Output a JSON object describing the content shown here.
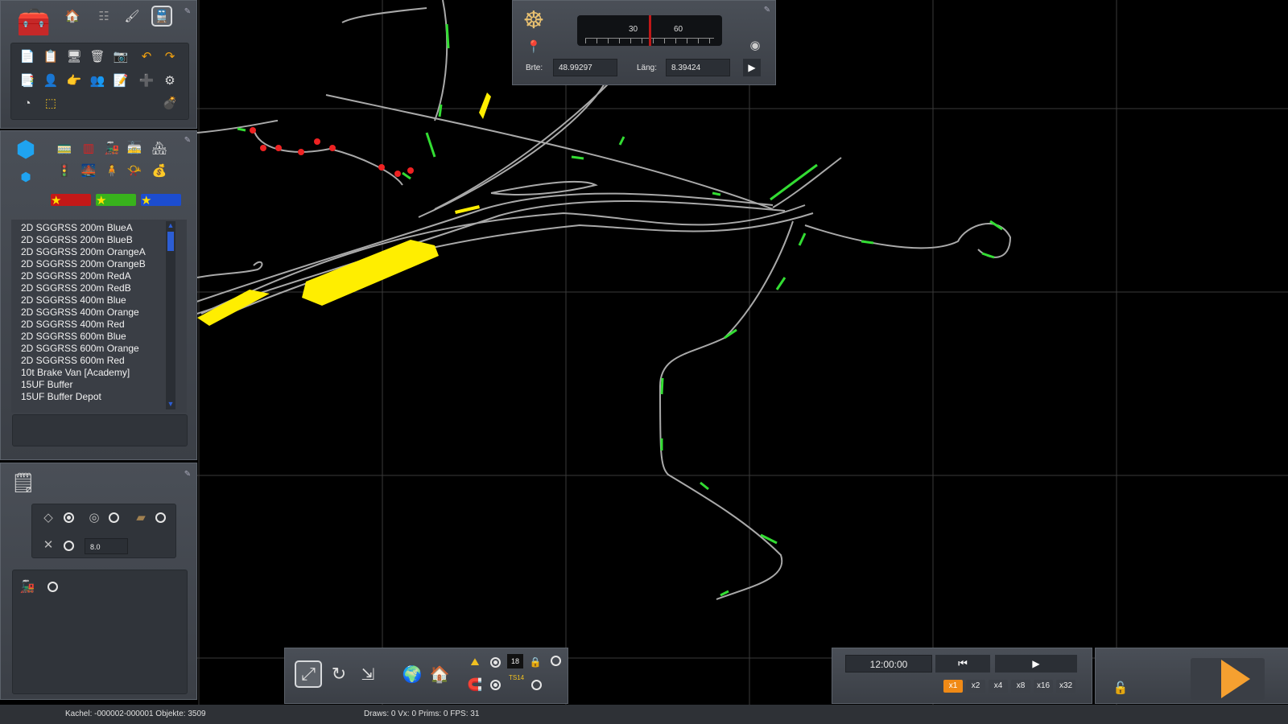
{
  "toolbox": {
    "tab_icons": [
      "toolbox-icon",
      "home-icon",
      "track-icon",
      "brush-icon",
      "train-icon"
    ],
    "tools_row1": [
      "copy-icon",
      "paste-icon",
      "monitor-icon",
      "delete-icon",
      "camera-icon",
      "undo-icon",
      "redo-icon"
    ],
    "tools_row2": [
      "bookmark-icon",
      "driver-icon",
      "hand-icon",
      "people-icon",
      "edit-icon",
      "add-person-icon",
      "settings-icon"
    ],
    "tools_row3": [
      "pie-chart-icon",
      "selection-icon"
    ]
  },
  "objects": {
    "category_icons": [
      "wagon-icon",
      "freight-car-icon",
      "locomotive-icon",
      "coach-icon",
      "building-icon",
      "signal-icon",
      "bridge-icon",
      "figure-icon",
      "horn-icon",
      "bag-icon"
    ],
    "filters": [
      "red-star-filter",
      "green-star-filter",
      "blue-star-filter"
    ],
    "items": [
      "2D SGGRSS 200m BlueA",
      "2D SGGRSS 200m BlueB",
      "2D SGGRSS 200m OrangeA",
      "2D SGGRSS 200m OrangeB",
      "2D SGGRSS 200m RedA",
      "2D SGGRSS 200m RedB",
      "2D SGGRSS 400m Blue",
      "2D SGGRSS 400m Orange",
      "2D SGGRSS 400m Red",
      "2D SGGRSS 600m Blue",
      "2D SGGRSS 600m Orange",
      "2D SGGRSS 600m Red",
      "10t Brake Van [Academy]",
      "15UF Buffer",
      "15UF Buffer Depot"
    ]
  },
  "properties": {
    "value": "8.0"
  },
  "compass": {
    "scale_labels": [
      "30",
      "60"
    ],
    "lat_label": "Brte:",
    "lat_value": "48.99297",
    "lon_label": "Läng:",
    "lon_value": "8.39424"
  },
  "view_toolbar": {
    "counter": "18",
    "tag": "TS14"
  },
  "timeline": {
    "time": "12:00:00",
    "speeds": [
      "x1",
      "x2",
      "x4",
      "x8",
      "x16",
      "x32"
    ],
    "active_speed": "x1"
  },
  "status": {
    "tile": "Kachel: -000002-000001  Objekte: 3509",
    "stats": "Draws: 0 Vx: 0 Prims: 0 FPS: 31"
  },
  "colors": {
    "track": "#a9a9a9",
    "signal": "#33dd33",
    "platform": "#ffee00",
    "marker": "#ee2222",
    "accent": "#f08a16"
  }
}
